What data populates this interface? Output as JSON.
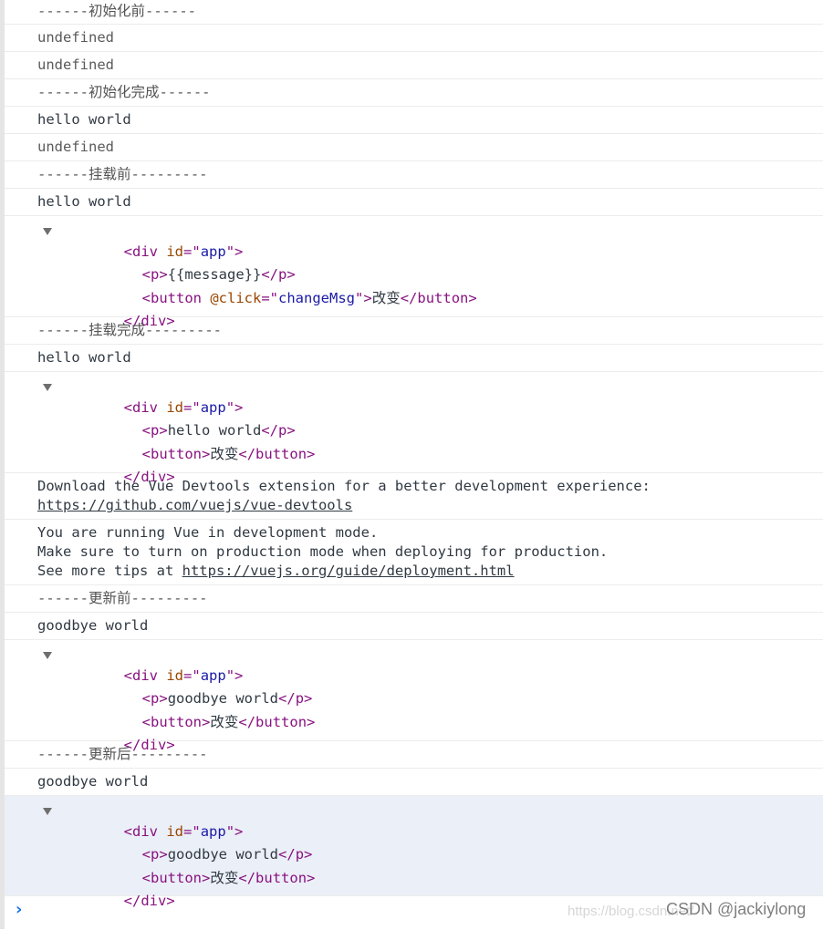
{
  "console": {
    "messages": [
      {
        "type": "text",
        "text": "------初始化前------"
      },
      {
        "type": "text",
        "text": "undefined"
      },
      {
        "type": "text",
        "text": "undefined"
      },
      {
        "type": "text",
        "text": "------初始化完成------"
      },
      {
        "type": "text",
        "text": "hello world"
      },
      {
        "type": "text",
        "text": "undefined"
      },
      {
        "type": "text",
        "text": "------挂载前---------"
      },
      {
        "type": "text",
        "text": "hello world"
      },
      {
        "type": "text",
        "text": "------挂载完成---------"
      },
      {
        "type": "text",
        "text": "hello world"
      },
      {
        "type": "text",
        "text": "------更新前---------"
      },
      {
        "type": "text",
        "text": "goodbye world"
      },
      {
        "type": "text",
        "text": "------更新后---------"
      },
      {
        "type": "text",
        "text": "goodbye world"
      }
    ],
    "trees": [
      {
        "div_open_tag": "div",
        "attr_name": "id",
        "attr_value": "app",
        "p_text": "{{message}}",
        "p_tag": "p",
        "button_tag": "button",
        "button_attr_name": "@click",
        "button_attr_value": "changeMsg",
        "button_text": "改变",
        "div_close_tag": "div"
      },
      {
        "div_open_tag": "div",
        "attr_name": "id",
        "attr_value": "app",
        "p_text": "hello world",
        "p_tag": "p",
        "button_tag": "button",
        "button_text": "改变",
        "div_close_tag": "div"
      },
      {
        "div_open_tag": "div",
        "attr_name": "id",
        "attr_value": "app",
        "p_text": "goodbye world",
        "p_tag": "p",
        "button_tag": "button",
        "button_text": "改变",
        "div_close_tag": "div"
      },
      {
        "div_open_tag": "div",
        "attr_name": "id",
        "attr_value": "app",
        "p_text": "goodbye world",
        "p_tag": "p",
        "button_tag": "button",
        "button_text": "改变",
        "div_close_tag": "div"
      }
    ],
    "devtools_msg": {
      "line1": "Download the Vue Devtools extension for a better development experience:",
      "link": "https://github.com/vuejs/vue-devtools"
    },
    "dev_mode_msg": {
      "line1": "You are running Vue in development mode.",
      "line2": "Make sure to turn on production mode when deploying for production.",
      "line3_prefix": "See more tips at ",
      "link": "https://vuejs.org/guide/deployment.html"
    }
  },
  "watermark": {
    "faint": "https://blog.csdn.net/",
    "main": "CSDN @jackiylong"
  },
  "prompt_symbol": "›"
}
